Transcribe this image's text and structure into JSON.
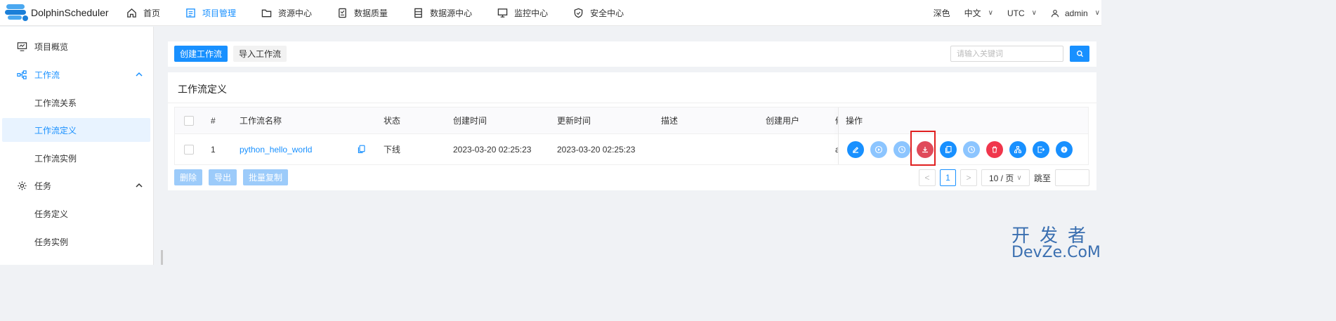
{
  "app": {
    "name": "DolphinScheduler"
  },
  "nav": [
    {
      "label": "首页",
      "icon": "home-icon",
      "active": false
    },
    {
      "label": "项目管理",
      "icon": "project-icon",
      "active": true
    },
    {
      "label": "资源中心",
      "icon": "folder-icon",
      "active": false
    },
    {
      "label": "数据质量",
      "icon": "quality-icon",
      "active": false
    },
    {
      "label": "数据源中心",
      "icon": "datasource-icon",
      "active": false
    },
    {
      "label": "监控中心",
      "icon": "monitor-icon",
      "active": false
    },
    {
      "label": "安全中心",
      "icon": "shield-icon",
      "active": false
    }
  ],
  "topright": {
    "theme": "深色",
    "language": "中文",
    "timezone": "UTC",
    "user": "admin"
  },
  "sidebar": {
    "overview": "项目概览",
    "workflow_group": "工作流",
    "workflow_items": [
      "工作流关系",
      "工作流定义",
      "工作流实例"
    ],
    "task_group": "任务",
    "task_items": [
      "任务定义",
      "任务实例"
    ]
  },
  "toolbar": {
    "create_label": "创建工作流",
    "import_label": "导入工作流",
    "search_placeholder": "请输入关键词"
  },
  "card": {
    "title": "工作流定义"
  },
  "table": {
    "columns": [
      "#",
      "工作流名称",
      "状态",
      "创建时间",
      "更新时间",
      "描述",
      "创建用户",
      "修",
      "操作"
    ],
    "rows": [
      {
        "index": "1",
        "name": "python_hello_world",
        "status": "下线",
        "created": "2023-03-20 02:25:23",
        "updated": "2023-03-20 02:25:23",
        "description": "",
        "creator": "",
        "modifier": "a"
      }
    ],
    "row_actions": [
      {
        "name": "edit-action",
        "icon": "edit-icon",
        "color": "#1890ff"
      },
      {
        "name": "run-action",
        "icon": "play-icon",
        "color": "#8cc5ff"
      },
      {
        "name": "timing-action",
        "icon": "clock-icon",
        "color": "#8cc5ff"
      },
      {
        "name": "offline-action",
        "icon": "download-icon",
        "color": "#e04a5a"
      },
      {
        "name": "copy-action",
        "icon": "copy-icon",
        "color": "#1890ff"
      },
      {
        "name": "cron-manage-action",
        "icon": "clock-icon",
        "color": "#8cc5ff"
      },
      {
        "name": "delete-action",
        "icon": "trash-icon",
        "color": "#f0364c"
      },
      {
        "name": "tree-view-action",
        "icon": "tree-icon",
        "color": "#1890ff"
      },
      {
        "name": "export-action",
        "icon": "export-icon",
        "color": "#1890ff"
      },
      {
        "name": "version-info-action",
        "icon": "info-icon",
        "color": "#1890ff"
      }
    ]
  },
  "bulk": {
    "delete_label": "删除",
    "export_label": "导出",
    "batch_copy_label": "批量复制"
  },
  "pagination": {
    "prev": "<",
    "current": "1",
    "next": ">",
    "page_size": "10 / 页",
    "jump_label": "跳至"
  },
  "watermark": {
    "top": "开发者",
    "bottom": "DevZe.CoM"
  }
}
